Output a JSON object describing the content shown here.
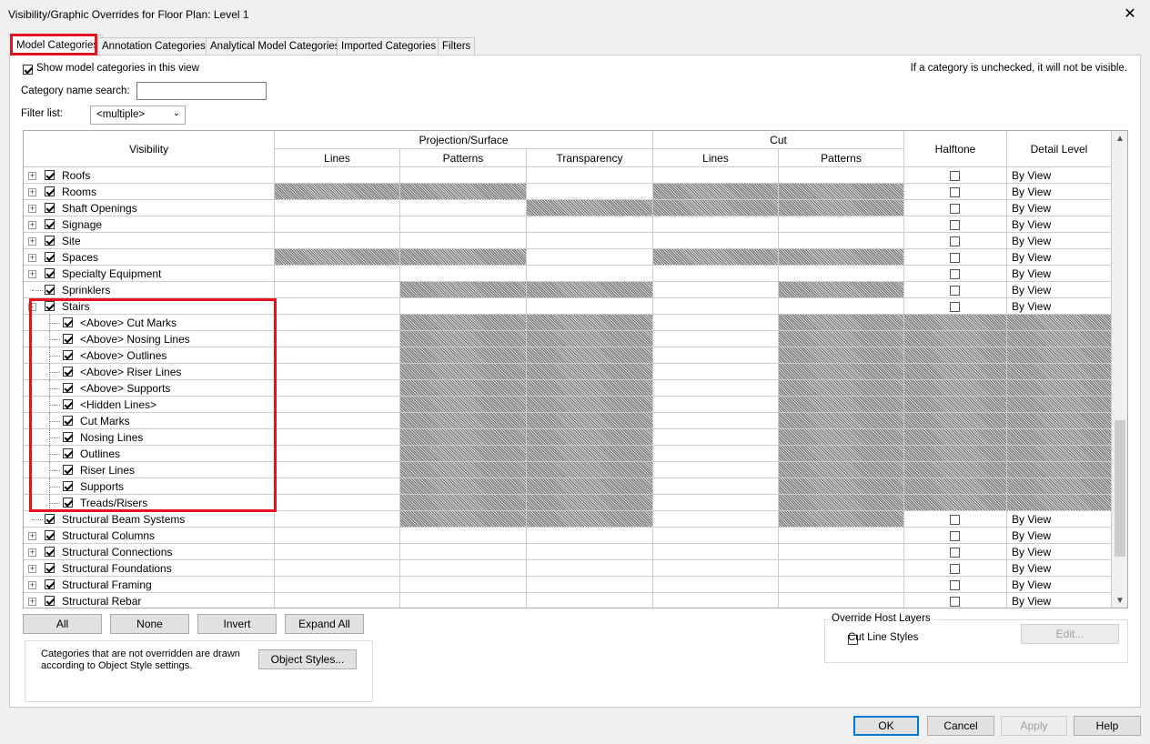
{
  "window": {
    "title": "Visibility/Graphic Overrides for Floor Plan: Level 1",
    "close": "✕"
  },
  "tabs": [
    "Model Categories",
    "Annotation Categories",
    "Analytical Model Categories",
    "Imported Categories",
    "Filters"
  ],
  "show_model": {
    "label": "Show model categories in this view",
    "checked": true
  },
  "hint": "If a category is unchecked, it will not be visible.",
  "search": {
    "label": "Category name search:",
    "value": ""
  },
  "filter_list": {
    "label": "Filter list:",
    "value": "<multiple>"
  },
  "columns": {
    "visibility": "Visibility",
    "projection": "Projection/Surface",
    "cut": "Cut",
    "lines": "Lines",
    "patterns": "Patterns",
    "transparency": "Transparency",
    "cut_lines": "Lines",
    "cut_patterns": "Patterns",
    "halftone": "Halftone",
    "detail_level": "Detail Level"
  },
  "rows": [
    {
      "name": "Roofs",
      "level": 0,
      "expander": "+",
      "detail": "By View"
    },
    {
      "name": "Rooms",
      "level": 0,
      "expander": "+",
      "detail": "By View"
    },
    {
      "name": "Shaft Openings",
      "level": 0,
      "expander": "+",
      "detail": "By View"
    },
    {
      "name": "Signage",
      "level": 0,
      "expander": "+",
      "detail": "By View"
    },
    {
      "name": "Site",
      "level": 0,
      "expander": "+",
      "detail": "By View"
    },
    {
      "name": "Spaces",
      "level": 0,
      "expander": "+",
      "detail": "By View"
    },
    {
      "name": "Specialty Equipment",
      "level": 0,
      "expander": "+",
      "detail": "By View"
    },
    {
      "name": "Sprinklers",
      "level": 0,
      "expander": "",
      "detail": "By View"
    },
    {
      "name": "Stairs",
      "level": 0,
      "expander": "-",
      "detail": "By View"
    },
    {
      "name": "<Above> Cut Marks",
      "level": 1,
      "expander": "",
      "detail": ""
    },
    {
      "name": "<Above> Nosing Lines",
      "level": 1,
      "expander": "",
      "detail": ""
    },
    {
      "name": "<Above> Outlines",
      "level": 1,
      "expander": "",
      "detail": ""
    },
    {
      "name": "<Above> Riser Lines",
      "level": 1,
      "expander": "",
      "detail": ""
    },
    {
      "name": "<Above> Supports",
      "level": 1,
      "expander": "",
      "detail": ""
    },
    {
      "name": "<Hidden Lines>",
      "level": 1,
      "expander": "",
      "detail": ""
    },
    {
      "name": "Cut Marks",
      "level": 1,
      "expander": "",
      "detail": ""
    },
    {
      "name": "Nosing Lines",
      "level": 1,
      "expander": "",
      "detail": ""
    },
    {
      "name": "Outlines",
      "level": 1,
      "expander": "",
      "detail": ""
    },
    {
      "name": "Riser Lines",
      "level": 1,
      "expander": "",
      "detail": ""
    },
    {
      "name": "Supports",
      "level": 1,
      "expander": "",
      "detail": ""
    },
    {
      "name": "Treads/Risers",
      "level": 1,
      "expander": "",
      "detail": ""
    },
    {
      "name": "Structural Beam Systems",
      "level": 0,
      "expander": "",
      "detail": "By View"
    },
    {
      "name": "Structural Columns",
      "level": 0,
      "expander": "+",
      "detail": "By View"
    },
    {
      "name": "Structural Connections",
      "level": 0,
      "expander": "+",
      "detail": "By View"
    },
    {
      "name": "Structural Foundations",
      "level": 0,
      "expander": "+",
      "detail": "By View"
    },
    {
      "name": "Structural Framing",
      "level": 0,
      "expander": "+",
      "detail": "By View"
    },
    {
      "name": "Structural Rebar",
      "level": 0,
      "expander": "+",
      "detail": "By View"
    }
  ],
  "buttons": {
    "all": "All",
    "none": "None",
    "invert": "Invert",
    "expand_all": "Expand All",
    "object_styles": "Object Styles...",
    "edit": "Edit...",
    "ok": "OK",
    "cancel": "Cancel",
    "apply": "Apply",
    "help": "Help"
  },
  "note": "Categories that are not overridden are drawn according to Object Style settings.",
  "override_host": {
    "title": "Override Host Layers",
    "cut_line_styles": "Cut Line Styles"
  },
  "colors": {
    "highlight": "#e1141f",
    "primary_border": "#0078d7"
  }
}
